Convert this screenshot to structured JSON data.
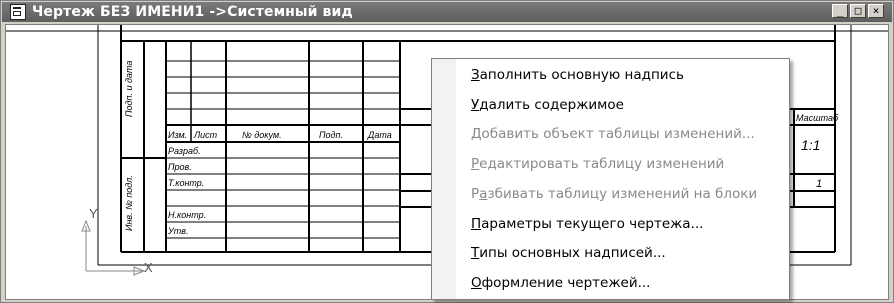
{
  "window": {
    "title": "Чертеж БЕЗ ИМЕНИ1 ->Системный вид",
    "buttons": {
      "minimize": "_",
      "maximize": "□",
      "close": "×"
    }
  },
  "stamp": {
    "side_labels": [
      "Подп. и дата",
      "Инв. № подл."
    ],
    "header": {
      "izm": "Изм.",
      "list": "Лист",
      "doc": "№ докум.",
      "podp": "Подп.",
      "data": "Дата"
    },
    "rows": [
      "Разраб.",
      "Пров.",
      "Т.контр.",
      "",
      "Н.контр.",
      "Утв."
    ],
    "right_header": "Масштаб",
    "scale_value": "1:1",
    "sheets_value": "1",
    "axis_y": "Y",
    "axis_x": "X"
  },
  "context_menu": {
    "items": [
      {
        "accel": "З",
        "rest": "аполнить основную надпись",
        "enabled": true
      },
      {
        "accel": "У",
        "rest": "далить содержимое",
        "enabled": true
      },
      {
        "accel": "Д",
        "rest": "обавить объект таблицы изменений...",
        "enabled": false
      },
      {
        "accel": "Р",
        "rest": "едактировать таблицу изменений",
        "enabled": false
      },
      {
        "pre": "Р",
        "accel": "а",
        "rest": "збивать таблицу изменений на блоки",
        "enabled": false
      },
      {
        "accel": "П",
        "rest": "араметры текущего чертежа...",
        "enabled": true
      },
      {
        "accel": "Т",
        "rest": "ипы основных надписей...",
        "enabled": true
      },
      {
        "accel": "О",
        "rest": "формление чертежей...",
        "enabled": true
      }
    ]
  }
}
